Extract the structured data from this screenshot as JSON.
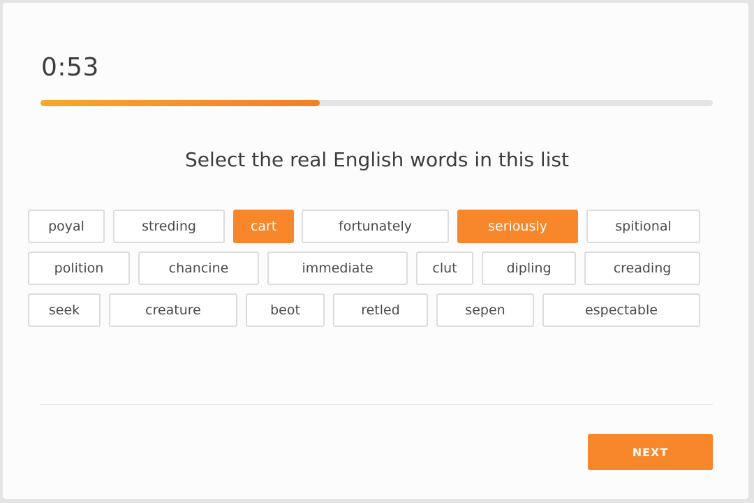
{
  "timer": "0:53",
  "progress": 0.415,
  "prompt": "Select the real English words in this list",
  "words": [
    {
      "text": "poyal",
      "selected": false
    },
    {
      "text": "streding",
      "selected": false
    },
    {
      "text": "cart",
      "selected": true
    },
    {
      "text": "fortunately",
      "selected": false
    },
    {
      "text": "seriously",
      "selected": true
    },
    {
      "text": "spitional",
      "selected": false
    },
    {
      "text": "polition",
      "selected": false
    },
    {
      "text": "chancine",
      "selected": false
    },
    {
      "text": "immediate",
      "selected": false
    },
    {
      "text": "clut",
      "selected": false
    },
    {
      "text": "dipling",
      "selected": false
    },
    {
      "text": "creading",
      "selected": false
    },
    {
      "text": "seek",
      "selected": false
    },
    {
      "text": "creature",
      "selected": false
    },
    {
      "text": "beot",
      "selected": false
    },
    {
      "text": "retled",
      "selected": false
    },
    {
      "text": "sepen",
      "selected": false
    },
    {
      "text": "espectable",
      "selected": false
    }
  ],
  "next_label": "NEXT",
  "colors": {
    "accent": "#f8862a",
    "progress_start": "#f7a928",
    "track": "#e5e5e5",
    "text": "#3c3c3c"
  }
}
